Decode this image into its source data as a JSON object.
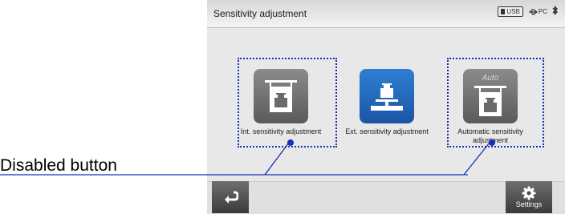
{
  "header": {
    "title": "Sensitivity adjustment",
    "usb_label": "USB",
    "pc_label": "PC",
    "pc_icon": "usb-connection-icon",
    "bluetooth_icon": "bluetooth-icon"
  },
  "buttons": {
    "internal": {
      "label": "Int. sensitivity adjustment",
      "icon": "weight-scale-icon",
      "state": "disabled"
    },
    "external": {
      "label": "Ext. sensitivity adjustment",
      "icon": "weight-scale-icon",
      "state": "enabled"
    },
    "automatic": {
      "label": "Automatic sensitivity adjustment",
      "icon": "weight-scale-icon",
      "badge": "Auto",
      "state": "disabled"
    }
  },
  "footer": {
    "back_icon": "return-arrow-icon",
    "settings_label": "Settings",
    "settings_icon": "gear-icon"
  },
  "annotation": {
    "text": "Disabled button"
  },
  "colors": {
    "highlight": "#1530b8",
    "enabled_button": "#1f63b8",
    "disabled_button": "#707070"
  }
}
